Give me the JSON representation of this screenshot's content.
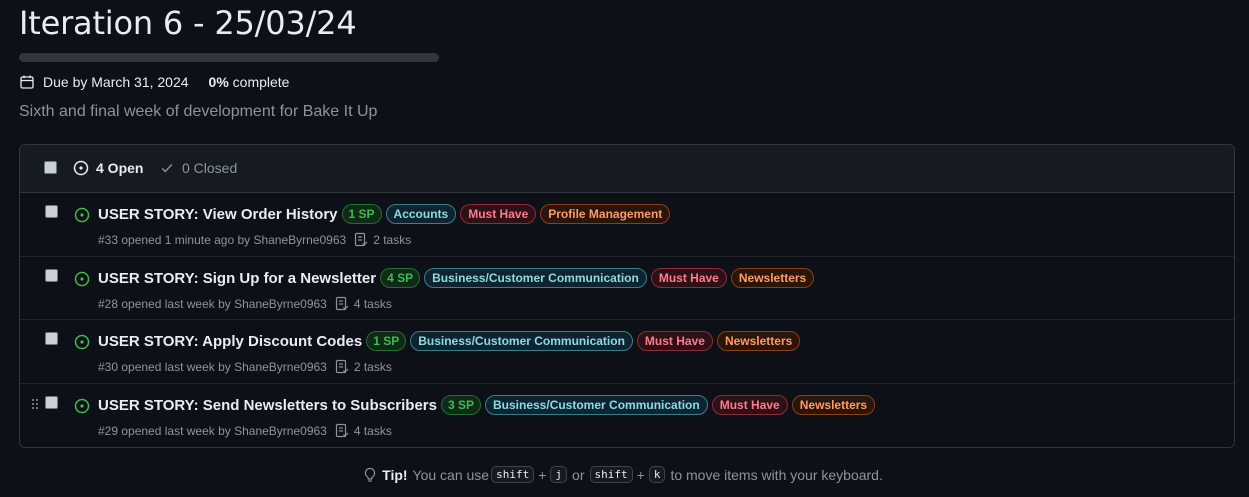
{
  "milestone": {
    "title": "Iteration 6 - 25/03/24",
    "progress_fraction": 0,
    "due": "Due by March 31, 2024",
    "percent": "0%",
    "percent_suffix": " complete",
    "description": "Sixth and final week of development for Bake It Up"
  },
  "list_header": {
    "open_label": "4 Open",
    "closed_label": "0 Closed"
  },
  "issues": [
    {
      "title": "USER STORY: View Order History",
      "labels": [
        {
          "text": "1 SP",
          "kind": "sp"
        },
        {
          "text": "Accounts",
          "kind": "accounts"
        },
        {
          "text": "Must Have",
          "kind": "must"
        },
        {
          "text": "Profile Management",
          "kind": "profile"
        }
      ],
      "meta": "#33 opened 1 minute ago by ShaneByrne0963",
      "tasks": "2 tasks"
    },
    {
      "title": "USER STORY: Sign Up for a Newsletter",
      "labels": [
        {
          "text": "4 SP",
          "kind": "sp"
        },
        {
          "text": "Business/Customer Communication",
          "kind": "comm"
        },
        {
          "text": "Must Have",
          "kind": "must"
        },
        {
          "text": "Newsletters",
          "kind": "news"
        }
      ],
      "meta": "#28 opened last week by ShaneByrne0963",
      "tasks": "4 tasks"
    },
    {
      "title": "USER STORY: Apply Discount Codes",
      "labels": [
        {
          "text": "1 SP",
          "kind": "sp"
        },
        {
          "text": "Business/Customer Communication",
          "kind": "comm"
        },
        {
          "text": "Must Have",
          "kind": "must"
        },
        {
          "text": "Newsletters",
          "kind": "news"
        }
      ],
      "meta": "#30 opened last week by ShaneByrne0963",
      "tasks": "2 tasks"
    },
    {
      "title": "USER STORY: Send Newsletters to Subscribers",
      "labels": [
        {
          "text": "3 SP",
          "kind": "sp"
        },
        {
          "text": "Business/Customer Communication",
          "kind": "comm"
        },
        {
          "text": "Must Have",
          "kind": "must"
        },
        {
          "text": "Newsletters",
          "kind": "news"
        }
      ],
      "meta": "#29 opened last week by ShaneByrne0963",
      "tasks": "4 tasks"
    }
  ],
  "tip": {
    "label": "Tip!",
    "text1": "You can use",
    "key1": "shift",
    "plus": "+",
    "key2": "j",
    "or": "or",
    "key3": "shift",
    "key4": "k",
    "text2": "to move items with your keyboard."
  },
  "colors": {
    "open_green": "#3fb950",
    "background": "#0d1117"
  }
}
